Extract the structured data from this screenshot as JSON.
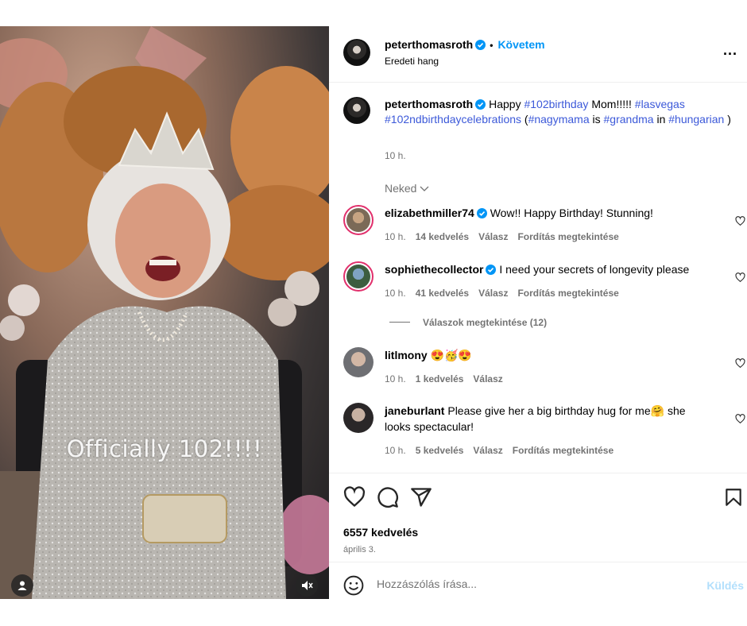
{
  "media": {
    "overlay_text": "Officially 102!!!!",
    "balloon_digits": "102"
  },
  "header": {
    "username": "peterthomasroth",
    "follow_label": "Követem",
    "audio": "Eredeti hang",
    "more": "..."
  },
  "caption": {
    "username": "peterthomasroth",
    "segments": [
      {
        "t": "Happy ",
        "tag": false
      },
      {
        "t": "#102birthday",
        "tag": true
      },
      {
        "t": " Mom!!!!! ",
        "tag": false
      },
      {
        "t": "#lasvegas",
        "tag": true
      },
      {
        "t": " ",
        "tag": false
      },
      {
        "t": "#102ndbirthdaycelebrations",
        "tag": true
      },
      {
        "t": " (",
        "tag": false
      },
      {
        "t": "#nagymama",
        "tag": true
      },
      {
        "t": " is ",
        "tag": false
      },
      {
        "t": "#grandma",
        "tag": true
      },
      {
        "t": " in ",
        "tag": false
      },
      {
        "t": "#hungarian",
        "tag": true
      },
      {
        "t": " )",
        "tag": false
      }
    ],
    "time": "10 h."
  },
  "sort_label": "Neked",
  "comments": [
    {
      "username": "elizabethmiller74",
      "verified": true,
      "text": "Wow!! Happy Birthday! Stunning!",
      "time": "10 h.",
      "likes": "14 kedvelés",
      "reply": "Válasz",
      "translate": "Fordítás megtekintése"
    },
    {
      "username": "sophiethecollector",
      "verified": true,
      "text": "I need your secrets of longevity please",
      "time": "10 h.",
      "likes": "41 kedvelés",
      "reply": "Válasz",
      "translate": "Fordítás megtekintése"
    },
    {
      "username": "litlmony",
      "verified": false,
      "text": "😍🥳😍",
      "time": "10 h.",
      "likes": "1 kedvelés",
      "reply": "Válasz",
      "translate": ""
    },
    {
      "username": "janeburlant",
      "verified": false,
      "text": "Please give her a big birthday hug for me🤗 she looks spectacular!",
      "time": "10 h.",
      "likes": "5 kedvelés",
      "reply": "Válasz",
      "translate": "Fordítás megtekintése"
    }
  ],
  "view_replies": "Válaszok megtekintése (12)",
  "likes_total": "6557 kedvelés",
  "post_date": "április 3.",
  "composer": {
    "placeholder": "Hozzászólás írása...",
    "post_label": "Küldés"
  },
  "colors": {
    "accent": "#0095f6",
    "hashtag": "#3c59d9",
    "secondary_text": "#737373",
    "story_ring": "#e1306c"
  }
}
